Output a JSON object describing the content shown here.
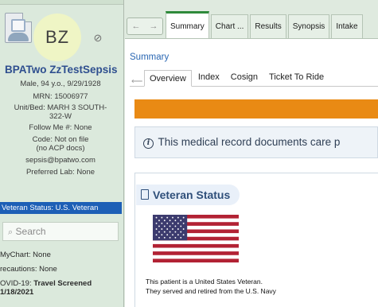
{
  "patient": {
    "initials": "BZ",
    "name": "BPATwo ZzTestSepsis",
    "demographics": "Male, 94 y.o., 9/29/1928",
    "mrn": "MRN: 15006977",
    "unit_bed_1": "Unit/Bed: MARH 3 SOUTH-",
    "unit_bed_2": "322-W",
    "follow_me": "Follow Me #: None",
    "code_1": "Code: Not on file",
    "code_2": "(no ACP docs)",
    "email": "sepsis@bpatwo.com",
    "preferred_lab": "Preferred Lab: None",
    "veteran_status": "Veteran Status: U.S. Veteran"
  },
  "sidebar": {
    "search_placeholder": "Search",
    "mychart": "MyChart: None",
    "precautions": "recautions: None",
    "covid_label": "OVID-19:",
    "covid_value": "Travel Screened",
    "covid_date": "1/18/2021"
  },
  "tabs": [
    "Summary",
    "Chart ...",
    "Results",
    "Synopsis",
    "Intake"
  ],
  "nav": {
    "back": "←",
    "forward": "→"
  },
  "main": {
    "title": "Summary",
    "subtabs": [
      "Overview",
      "Index",
      "Cosign",
      "Ticket To Ride"
    ],
    "notice": "This medical record documents care p",
    "veteran_card": {
      "heading": "Veteran Status",
      "line1": "This patient is a United States Veteran.",
      "line2": "They served and retired from the U.S. Navy"
    }
  },
  "colors": {
    "accent_blue": "#1d5fb6",
    "alert_orange": "#e98a14",
    "active_tab_green": "#2f8a3b"
  },
  "icons": [
    "avatar-card-icon",
    "camera-icon",
    "search-icon",
    "info-icon",
    "document-icon",
    "us-flag-image"
  ]
}
